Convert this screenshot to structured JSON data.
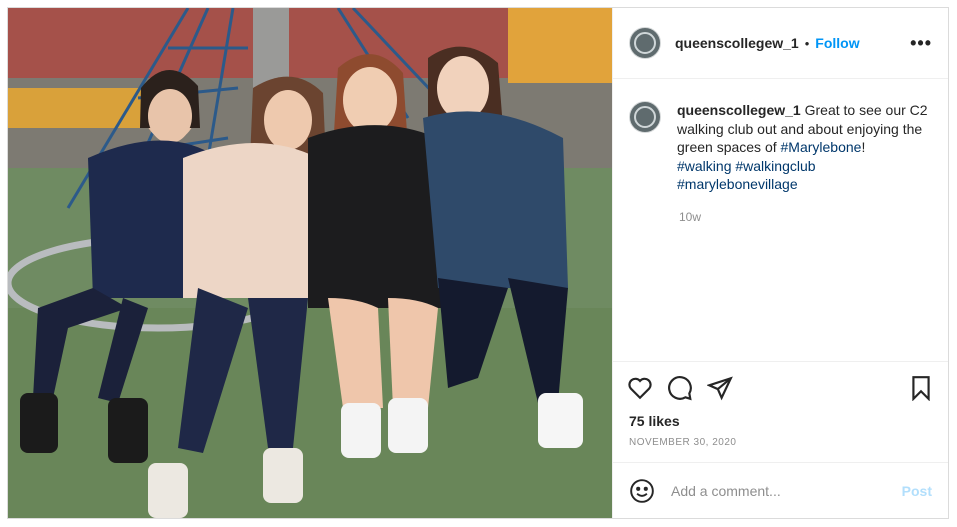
{
  "post": {
    "username": "queenscollegew_1",
    "follow_label": "Follow",
    "caption": {
      "username": "queenscollegew_1",
      "text_1": "Great to see our C2 walking club out and about enjoying the green spaces of",
      "tag_marylebone": "#Marylebone",
      "text_2": "!",
      "tag_walking": "#walking",
      "tag_walkingclub": "#walkingclub",
      "tag_village": "#marylebonevillage"
    },
    "time_ago": "10w",
    "likes": "75 likes",
    "date": "NOVEMBER 30, 2020",
    "comment_placeholder": "Add a comment...",
    "post_label": "Post"
  },
  "icons": {
    "like": "heart-icon",
    "comment": "comment-icon",
    "share": "paper-plane-icon",
    "save": "bookmark-icon",
    "emoji": "smiley-icon",
    "more": "more-options-icon"
  },
  "colors": {
    "accent": "#0095f6",
    "hashtag": "#00376b",
    "muted": "#8e8e8e",
    "post_disabled": "#b2dffc"
  }
}
